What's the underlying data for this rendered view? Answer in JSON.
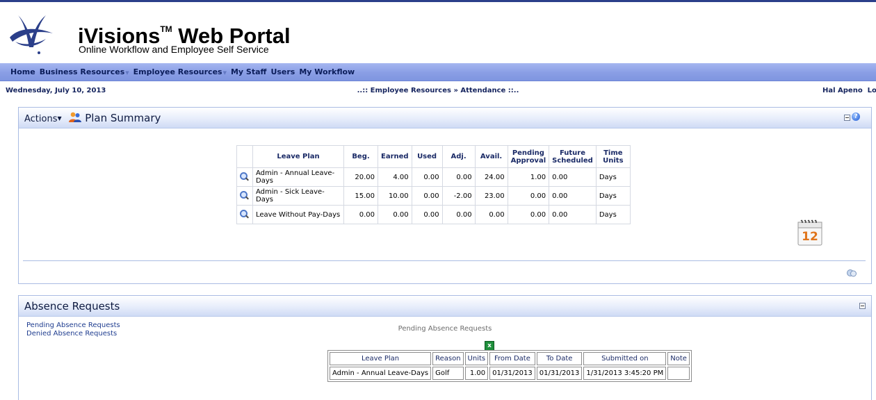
{
  "brand": {
    "title": "iVisions",
    "trademark": "TM",
    "title_suffix": " Web Portal",
    "subtitle": "Online Workflow and Employee Self Service",
    "logo_color": "#2b3f8a"
  },
  "menu": {
    "items": [
      {
        "label": "Home",
        "has_dropdown": false
      },
      {
        "label": "Business Resources",
        "has_dropdown": true
      },
      {
        "label": "Employee Resources",
        "has_dropdown": true
      },
      {
        "label": "My Staff",
        "has_dropdown": false
      },
      {
        "label": "Users",
        "has_dropdown": false
      },
      {
        "label": "My Workflow",
        "has_dropdown": false
      }
    ]
  },
  "infobar": {
    "date": "Wednesday, July 10, 2013",
    "breadcrumb": "..:: Employee Resources » Attendance ::..",
    "user_name": "Hal Apeno",
    "logout": "Logo"
  },
  "plan_summary": {
    "actions_label": "Actions",
    "title": "Plan Summary",
    "columns": [
      "Leave Plan",
      "Beg.",
      "Earned",
      "Used",
      "Adj.",
      "Avail.",
      "Pending Approval",
      "Future Scheduled",
      "Time Units"
    ],
    "rows": [
      {
        "leave_plan": "Admin - Annual Leave-Days",
        "beg": "20.00",
        "earned": "4.00",
        "used": "0.00",
        "adj": "0.00",
        "avail": "24.00",
        "pending": "1.00",
        "future": "0.00",
        "units": "Days"
      },
      {
        "leave_plan": "Admin - Sick Leave-Days",
        "beg": "15.00",
        "earned": "10.00",
        "used": "0.00",
        "adj": "-2.00",
        "avail": "23.00",
        "pending": "0.00",
        "future": "0.00",
        "units": "Days"
      },
      {
        "leave_plan": "Leave Without Pay-Days",
        "beg": "0.00",
        "earned": "0.00",
        "used": "0.00",
        "adj": "0.00",
        "avail": "0.00",
        "pending": "0.00",
        "future": "0.00",
        "units": "Days"
      }
    ],
    "calendar_day": "12"
  },
  "absence_requests": {
    "title": "Absence Requests",
    "links": [
      "Pending Absence Requests",
      "Denied Absence Requests"
    ],
    "caption": "Pending Absence Requests",
    "columns": [
      "Leave Plan",
      "Reason",
      "Units",
      "From Date",
      "To Date",
      "Submitted on",
      "Note"
    ],
    "rows": [
      {
        "leave_plan": "Admin - Annual Leave-Days",
        "reason": "Golf",
        "units": "1.00",
        "from": "01/31/2013",
        "to": "01/31/2013",
        "submitted": "1/31/2013 3:45:20 PM",
        "note": ""
      }
    ]
  },
  "icons": {
    "logo": "ivisions-logo",
    "plan_summary_icon": "people-icon",
    "view_row": "magnifier-icon",
    "calendar": "calendar-icon",
    "refresh": "refresh-icon",
    "excel": "excel-export-icon",
    "collapse": "collapse-icon",
    "help": "help-icon"
  },
  "colors": {
    "menubar": "#8a9ee5",
    "panel_border": "#a9bbe3",
    "header_text": "#0e1a40",
    "link": "#1e3c8f"
  }
}
